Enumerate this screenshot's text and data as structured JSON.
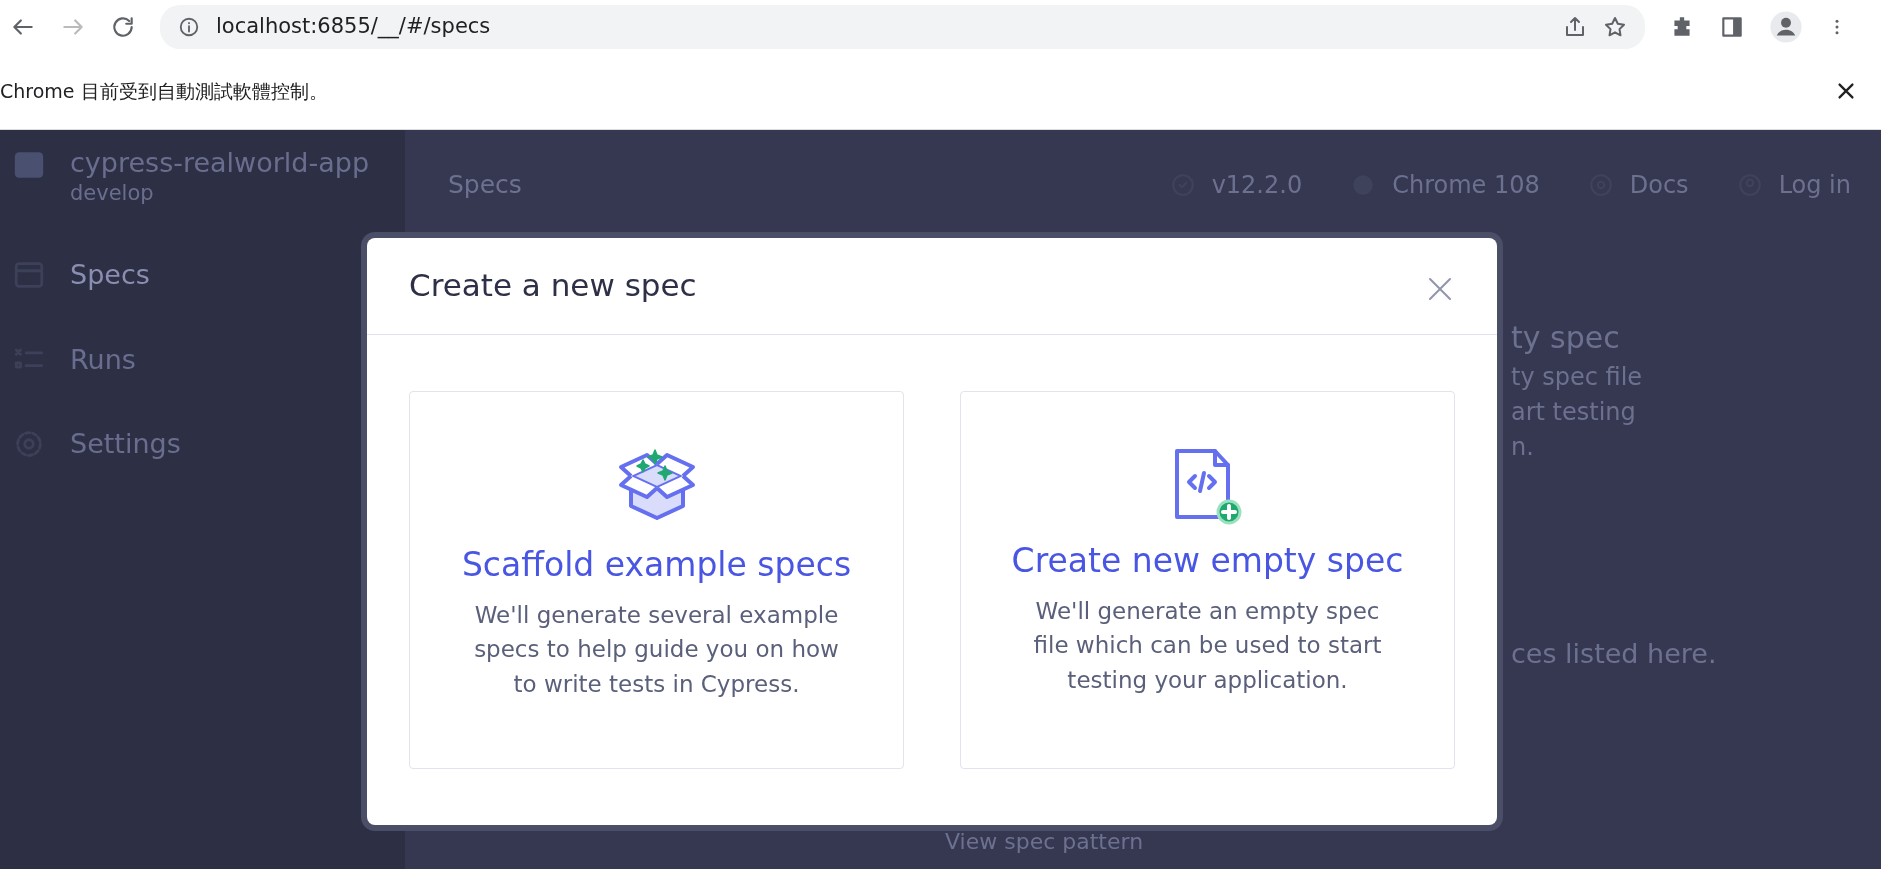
{
  "browser": {
    "url": "localhost:6855/__/#/specs",
    "infobar_text": "Chrome 目前受到自動測試軟體控制。"
  },
  "sidebar": {
    "project": "cypress-realworld-app",
    "branch": "develop",
    "items": [
      {
        "label": "Specs",
        "kind": "specs",
        "selected": true
      },
      {
        "label": "Runs",
        "kind": "runs",
        "selected": false
      },
      {
        "label": "Settings",
        "kind": "settings",
        "selected": false
      }
    ]
  },
  "header": {
    "title": "Specs",
    "items": [
      {
        "label": "v12.2.0",
        "kind": "version"
      },
      {
        "label": "Chrome 108",
        "kind": "browser"
      },
      {
        "label": "Docs",
        "kind": "docs"
      },
      {
        "label": "Log in",
        "kind": "login"
      }
    ]
  },
  "background_fragments": {
    "heading": "ty spec",
    "lines": [
      "ty spec file",
      "art testing",
      "n."
    ],
    "footer": "ces listed here.",
    "link": "View spec pattern"
  },
  "modal": {
    "title": "Create a new spec",
    "cards": [
      {
        "kind": "scaffold",
        "title": "Scaffold example specs",
        "description": "We'll generate several example specs to help guide you on how to write tests in Cypress."
      },
      {
        "kind": "empty",
        "title": "Create new empty spec",
        "description": "We'll generate an empty spec file which can be used to start testing your application."
      }
    ]
  }
}
